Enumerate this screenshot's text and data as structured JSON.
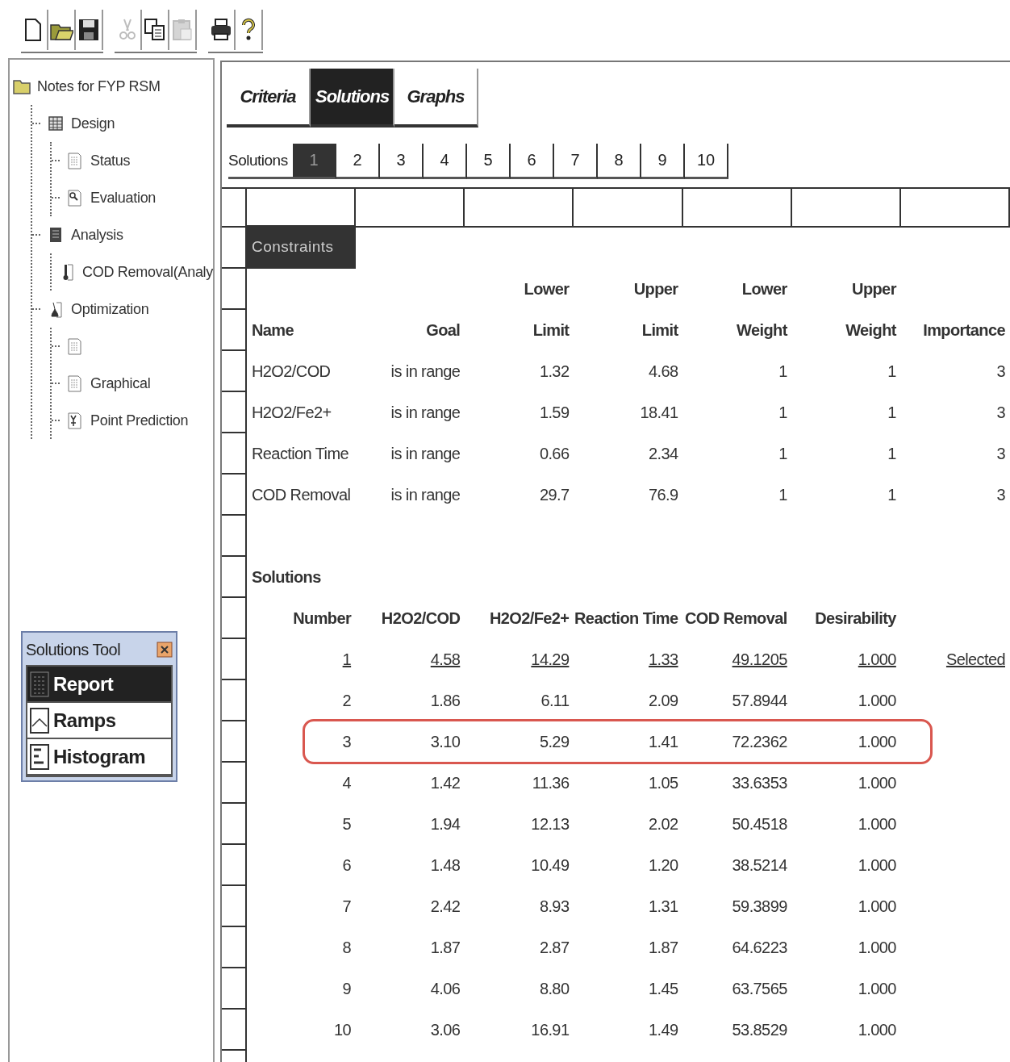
{
  "toolbar": {
    "groups": [
      [
        {
          "kind": "new",
          "disabled": false
        },
        {
          "kind": "open",
          "disabled": false
        },
        {
          "kind": "save",
          "disabled": false
        }
      ],
      [
        {
          "kind": "cut",
          "disabled": true
        },
        {
          "kind": "copy",
          "disabled": false
        },
        {
          "kind": "paste",
          "disabled": true
        }
      ],
      [
        {
          "kind": "print",
          "disabled": false
        },
        {
          "kind": "help",
          "disabled": false
        }
      ]
    ]
  },
  "tree": {
    "label": "Notes for FYP RSM",
    "kind": "folder",
    "children": [
      {
        "label": "Design",
        "kind": "grid",
        "children": [
          {
            "label": "Status",
            "kind": "sheet"
          },
          {
            "label": "Evaluation",
            "kind": "magnifier"
          }
        ]
      },
      {
        "label": "Analysis",
        "kind": "book",
        "children": [
          {
            "label": "COD Removal(Analy",
            "kind": "thermometer"
          }
        ]
      },
      {
        "label": "Optimization",
        "kind": "lamp",
        "children": [
          {
            "kind": "sheet"
          },
          {
            "label": "Graphical",
            "kind": "sheet"
          },
          {
            "label": "Point Prediction",
            "kind": "prediction"
          }
        ]
      }
    ]
  },
  "solutions_tool": {
    "title": "Solutions Tool",
    "items": [
      {
        "label": "Report",
        "kind": "table",
        "selected": true
      },
      {
        "label": "Ramps",
        "kind": "ramp",
        "selected": false
      },
      {
        "label": "Histogram",
        "kind": "histogram",
        "selected": false
      }
    ]
  },
  "main_tabs": [
    {
      "label": "Criteria",
      "selected": false
    },
    {
      "label": "Solutions",
      "selected": true
    },
    {
      "label": "Graphs",
      "selected": false
    }
  ],
  "solution_tabs": {
    "label": "Solutions",
    "items": [
      {
        "label": "1",
        "selected": true
      },
      {
        "label": "2",
        "selected": false
      },
      {
        "label": "3",
        "selected": false
      },
      {
        "label": "4",
        "selected": false
      },
      {
        "label": "5",
        "selected": false
      },
      {
        "label": "6",
        "selected": false
      },
      {
        "label": "7",
        "selected": false
      },
      {
        "label": "8",
        "selected": false
      },
      {
        "label": "9",
        "selected": false
      },
      {
        "label": "10",
        "selected": false
      }
    ]
  },
  "constraints": {
    "title": "Constraints",
    "columns": [
      {
        "label": "Name"
      },
      {
        "label": "Goal"
      },
      {
        "top": "Lower",
        "label": "Limit"
      },
      {
        "top": "Upper",
        "label": "Limit"
      },
      {
        "top": "Lower",
        "label": "Weight"
      },
      {
        "top": "Upper",
        "label": "Weight"
      },
      {
        "label": "Importance"
      }
    ],
    "rows": [
      [
        "H2O2/COD",
        "is in range",
        "1.32",
        "4.68",
        "1",
        "1",
        "3"
      ],
      [
        "H2O2/Fe2+",
        "is in range",
        "1.59",
        "18.41",
        "1",
        "1",
        "3"
      ],
      [
        "Reaction Time",
        "is in range",
        "0.66",
        "2.34",
        "1",
        "1",
        "3"
      ],
      [
        "COD Removal",
        "is in range",
        "29.7",
        "76.9",
        "1",
        "1",
        "3"
      ]
    ]
  },
  "solutions": {
    "title": "Solutions",
    "columns": [
      "Number",
      "H2O2/COD",
      "H2O2/Fe2+",
      "Reaction Time",
      "COD Removal",
      "Desirability"
    ],
    "selected_label": "Selected",
    "rows": [
      {
        "cells": [
          "1",
          "4.58",
          "14.29",
          "1.33",
          "49.1205",
          "1.000"
        ],
        "selected": true,
        "highlighted": false
      },
      {
        "cells": [
          "2",
          "1.86",
          "6.11",
          "2.09",
          "57.8944",
          "1.000"
        ],
        "selected": false,
        "highlighted": false
      },
      {
        "cells": [
          "3",
          "3.10",
          "5.29",
          "1.41",
          "72.2362",
          "1.000"
        ],
        "selected": false,
        "highlighted": true
      },
      {
        "cells": [
          "4",
          "1.42",
          "11.36",
          "1.05",
          "33.6353",
          "1.000"
        ],
        "selected": false,
        "highlighted": false
      },
      {
        "cells": [
          "5",
          "1.94",
          "12.13",
          "2.02",
          "50.4518",
          "1.000"
        ],
        "selected": false,
        "highlighted": false
      },
      {
        "cells": [
          "6",
          "1.48",
          "10.49",
          "1.20",
          "38.5214",
          "1.000"
        ],
        "selected": false,
        "highlighted": false
      },
      {
        "cells": [
          "7",
          "2.42",
          "8.93",
          "1.31",
          "59.3899",
          "1.000"
        ],
        "selected": false,
        "highlighted": false
      },
      {
        "cells": [
          "8",
          "1.87",
          "2.87",
          "1.87",
          "64.6223",
          "1.000"
        ],
        "selected": false,
        "highlighted": false
      },
      {
        "cells": [
          "9",
          "4.06",
          "8.80",
          "1.45",
          "63.7565",
          "1.000"
        ],
        "selected": false,
        "highlighted": false
      },
      {
        "cells": [
          "10",
          "3.06",
          "16.91",
          "1.49",
          "53.8529",
          "1.000"
        ],
        "selected": false,
        "highlighted": false
      }
    ]
  }
}
